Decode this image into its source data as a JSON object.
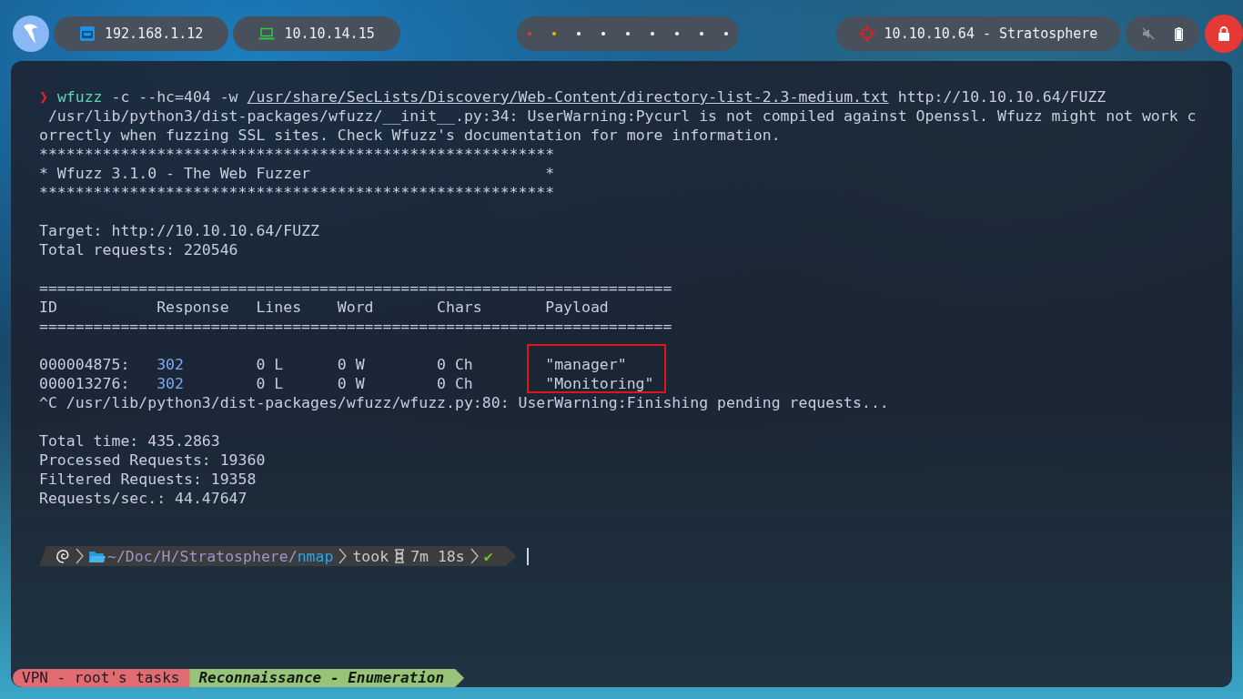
{
  "top_bar": {
    "network": [
      {
        "kind": "ethernet",
        "address": "192.168.1.12"
      },
      {
        "kind": "vpn",
        "address": "10.10.14.15"
      }
    ],
    "workspaces": [
      {
        "color": "#e53935"
      },
      {
        "color": "#f6b400"
      },
      {
        "color": "#ffffff"
      },
      {
        "color": "#ffffff"
      },
      {
        "color": "#ffffff"
      },
      {
        "color": "#ffffff"
      },
      {
        "color": "#ffffff"
      },
      {
        "color": "#ffffff"
      },
      {
        "color": "#ffffff"
      }
    ],
    "target": "10.10.10.64 - Stratosphere",
    "muted": true
  },
  "terminal": {
    "highlight_payloads": true,
    "lines": [
      {
        "kind": "command",
        "symbol": "❯",
        "program": "wfuzz",
        "args": "-c --hc=404 -w",
        "wordlist": "/usr/share/SecLists/Discovery/Web-Content/directory-list-2.3-medium.txt",
        "url": "http://10.10.10.64/FUZZ"
      },
      {
        "kind": "text",
        "text": " /usr/lib/python3/dist-packages/wfuzz/__init__.py:34: UserWarning:Pycurl is not compiled against Openssl. Wfuzz might not work c"
      },
      {
        "kind": "text",
        "text": "orrectly when fuzzing SSL sites. Check Wfuzz's documentation for more information."
      },
      {
        "kind": "text",
        "text": "*********************************************************"
      },
      {
        "kind": "text",
        "text": "* Wfuzz 3.1.0 - The Web Fuzzer                          *"
      },
      {
        "kind": "text",
        "text": "*********************************************************"
      },
      {
        "kind": "blank"
      },
      {
        "kind": "text",
        "text": "Target: http://10.10.10.64/FUZZ"
      },
      {
        "kind": "text",
        "text": "Total requests: 220546"
      },
      {
        "kind": "blank"
      },
      {
        "kind": "text",
        "text": "======================================================================"
      },
      {
        "kind": "header",
        "cells": [
          "ID",
          "Response",
          "Lines",
          "Word",
          "Chars",
          "Payload"
        ]
      },
      {
        "kind": "text",
        "text": "======================================================================"
      },
      {
        "kind": "blank"
      },
      {
        "kind": "row",
        "cells": [
          "000004875:",
          "302",
          "0 L",
          "0 W",
          "0 Ch",
          "\"manager\""
        ]
      },
      {
        "kind": "row",
        "cells": [
          "000013276:",
          "302",
          "0 L",
          "0 W",
          "0 Ch",
          "\"Monitoring\""
        ]
      },
      {
        "kind": "text",
        "text": "^C /usr/lib/python3/dist-packages/wfuzz/wfuzz.py:80: UserWarning:Finishing pending requests..."
      },
      {
        "kind": "blank"
      },
      {
        "kind": "text",
        "text": "Total time: 435.2863"
      },
      {
        "kind": "text",
        "text": "Processed Requests: 19360"
      },
      {
        "kind": "text",
        "text": "Filtered Requests: 19358"
      },
      {
        "kind": "text",
        "text": "Requests/sec.: 44.47647"
      },
      {
        "kind": "blank"
      },
      {
        "kind": "blank"
      }
    ],
    "prompt": {
      "path": "~/Doc/H/Stratosphere/",
      "current_dir": "nmap",
      "took_label": "took",
      "duration": "7m 18s",
      "status": "✔"
    }
  },
  "tmux": {
    "session": "VPN - root's tasks",
    "window": "Reconnaissance - Enumeration"
  }
}
